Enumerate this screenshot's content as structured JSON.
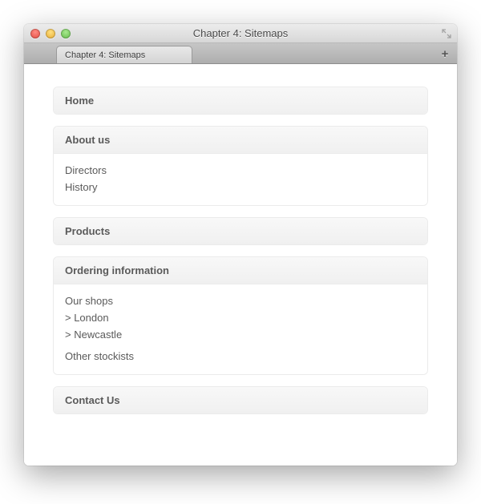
{
  "window": {
    "title": "Chapter 4: Sitemaps"
  },
  "tabs": {
    "active": "Chapter 4: Sitemaps"
  },
  "sitemap": {
    "home": "Home",
    "about": {
      "title": "About us",
      "items": [
        "Directors",
        "History"
      ]
    },
    "products": "Products",
    "ordering": {
      "title": "Ordering information",
      "shops_label": "Our shops",
      "shops": [
        "> London",
        "> Newcastle"
      ],
      "other": "Other stockists"
    },
    "contact": "Contact Us"
  }
}
